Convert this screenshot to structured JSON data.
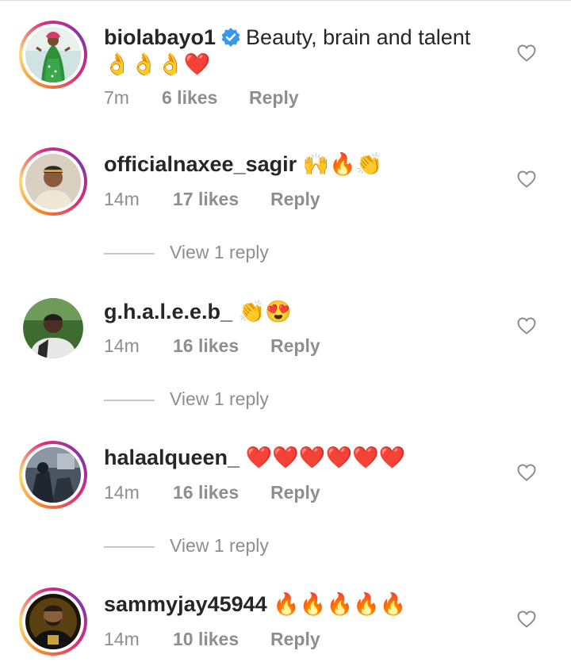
{
  "comments": [
    {
      "username": "biolabayo1",
      "verified": true,
      "text": "Beauty, brain and talent",
      "emoji": "👌👌👌❤️",
      "time": "7m",
      "likes": "6 likes",
      "reply": "Reply",
      "avatar_icon": "avatar-woman-green-dress",
      "story_ring": true
    },
    {
      "username": "officialnaxee_sagir",
      "verified": false,
      "text": "🙌🔥👏",
      "time": "14m",
      "likes": "17 likes",
      "reply": "Reply",
      "view_replies": "View 1 reply",
      "avatar_icon": "avatar-man-cap",
      "story_ring": true
    },
    {
      "username": "g.h.a.l.e.e.b_",
      "verified": false,
      "text": "👏😍",
      "time": "14m",
      "likes": "16 likes",
      "reply": "Reply",
      "view_replies": "View 1 reply",
      "avatar_icon": "avatar-man-outdoor",
      "story_ring": false
    },
    {
      "username": "halaalqueen_",
      "verified": false,
      "text": "❤️❤️❤️❤️❤️❤️",
      "time": "14m",
      "likes": "16 likes",
      "reply": "Reply",
      "view_replies": "View 1 reply",
      "avatar_icon": "avatar-dark-scene",
      "story_ring": true
    },
    {
      "username": "sammyjay45944",
      "verified": false,
      "text": "🔥🔥🔥🔥🔥",
      "time": "14m",
      "likes": "10 likes",
      "reply": "Reply",
      "avatar_icon": "avatar-bearded-man-gold",
      "story_ring": true
    }
  ],
  "colors": {
    "text": "#262626",
    "meta": "#8e8e8e",
    "verified": "#3897f0",
    "divider": "#c7c7c7"
  }
}
